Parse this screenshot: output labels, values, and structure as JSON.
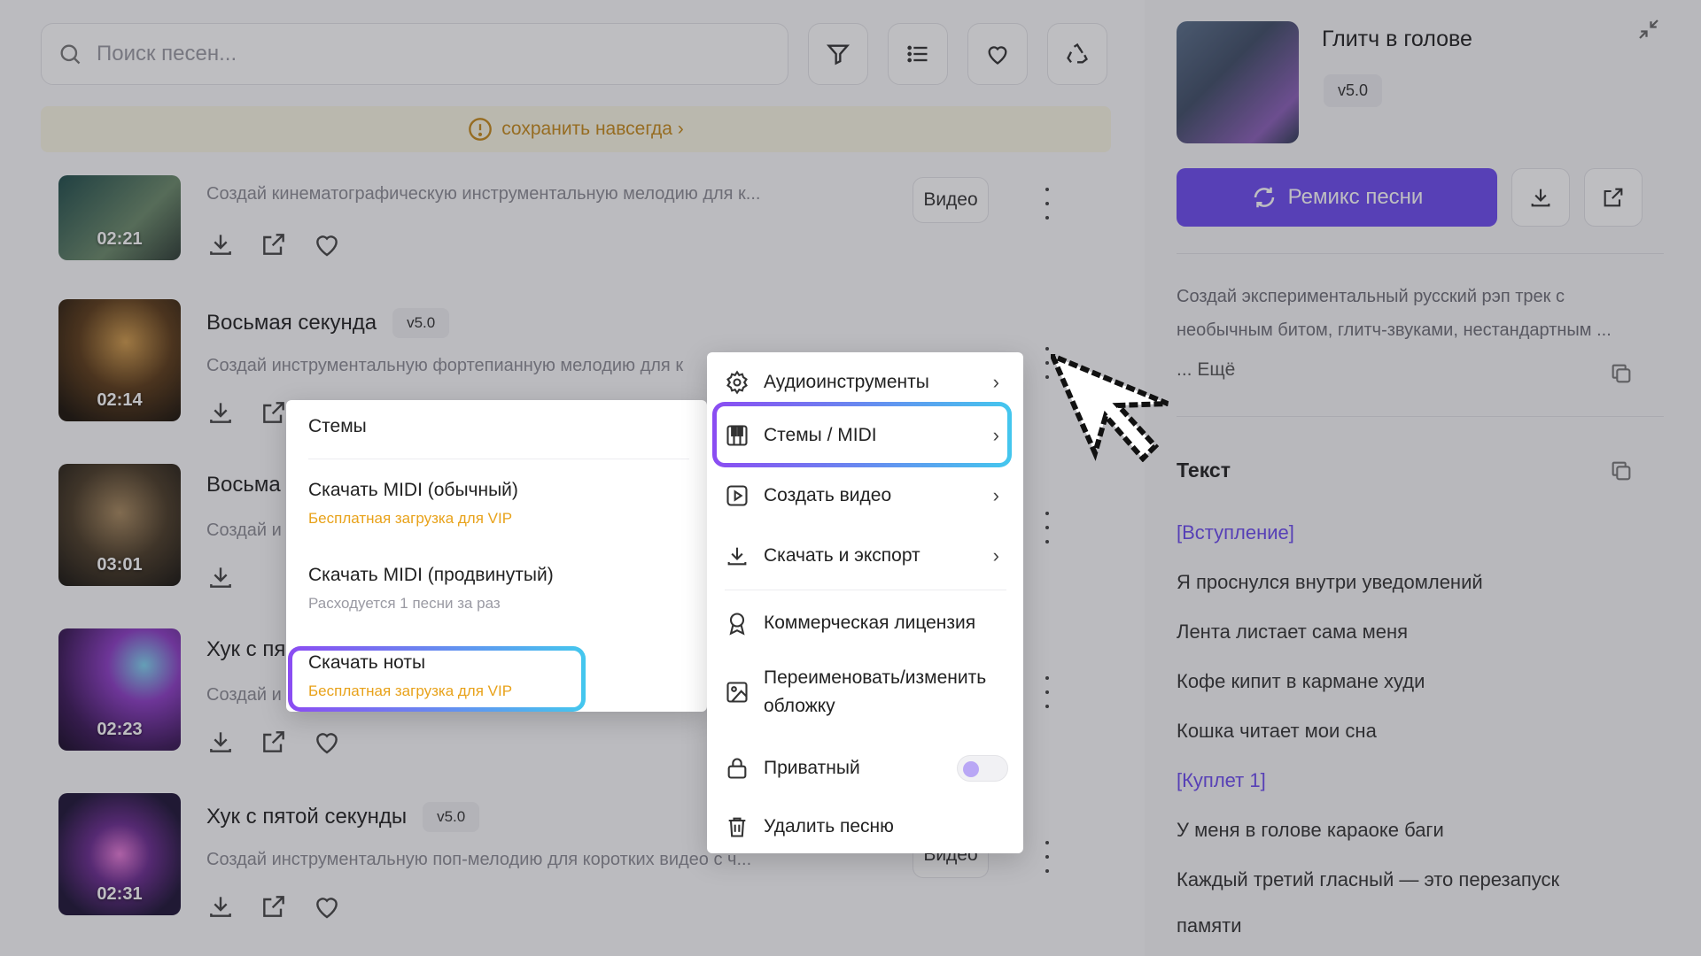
{
  "search": {
    "placeholder": "Поиск песен..."
  },
  "banner": {
    "text": "сохранить навсегда ›"
  },
  "tracks": [
    {
      "title": "",
      "version": "",
      "desc": "Создай кинематографическую инструментальную мелодию для к...",
      "duration": "02:21",
      "video": "Видео"
    },
    {
      "title": "Восьмая секунда",
      "version": "v5.0",
      "desc": "Создай инструментальную фортепианную мелодию для к",
      "duration": "02:14",
      "video": ""
    },
    {
      "title": "Восьма",
      "version": "",
      "desc": "Создай и",
      "duration": "03:01",
      "video": ""
    },
    {
      "title": "Хук с пя",
      "version": "",
      "desc": "Создай и",
      "duration": "02:23",
      "video": ""
    },
    {
      "title": "Хук с пятой секунды",
      "version": "v5.0",
      "desc": "Создай инструментальную поп-мелодию для коротких видео с ч...",
      "duration": "02:31",
      "video": "Видео"
    }
  ],
  "panel": {
    "title": "Глитч в голове",
    "version": "v5.0",
    "remix": "Ремикс песни",
    "desc": "Создай экспериментальный русский рэп трек с необычным битом, глитч-звуками, нестандартным ...",
    "more": "... Ещё",
    "lyrics_head": "Текст",
    "lyrics": [
      "[Вступление]",
      "Я проснулся внутри уведомлений",
      "Лента листает сама меня",
      "Кофе кипит в кармане худи",
      "Кошка читает мои сна",
      "[Куплет 1]",
      "У меня в голове караоке баги",
      "Каждый третий гласный — это перезапуск",
      "памяти"
    ]
  },
  "context_menu": {
    "items": [
      "Аудиоинструменты",
      "Стемы / MIDI",
      "Создать видео",
      "Скачать и экспорт",
      "Коммерческая лицензия",
      "Переименовать/изменить обложку",
      "Приватный",
      "Удалить песню"
    ]
  },
  "submenu": {
    "head": "Стемы",
    "items": [
      {
        "label": "Скачать MIDI (обычный)",
        "note": "Бесплатная загрузка для VIP"
      },
      {
        "label": "Скачать MIDI (продвинутый)",
        "note": "Расходуется 1 песни за раз"
      },
      {
        "label": "Скачать ноты",
        "note": "Бесплатная загрузка для VIP"
      }
    ]
  },
  "colors": {
    "accent": "#6c4bf0",
    "vip": "#e8a21a",
    "highlight_from": "#8b4cf2",
    "highlight_to": "#44c7ee"
  }
}
